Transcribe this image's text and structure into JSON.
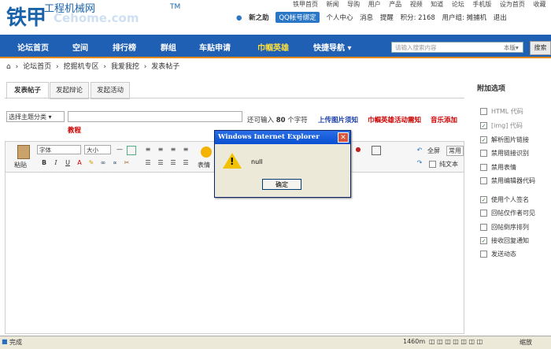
{
  "logo": {
    "brand": "铁甲",
    "subtitle": "工程机械网",
    "trademark": "TM",
    "watermark": "Cehome.com"
  },
  "toplinks": [
    "铁甲首页",
    "新闻",
    "导购",
    "用户",
    "产品",
    "视频",
    "知道",
    "论坛",
    "手机版",
    "设为首页",
    "收藏"
  ],
  "userbar": {
    "username": "新之助",
    "qq_bind": "QQ帐号绑定",
    "links": [
      "个人中心",
      "消息",
      "提醒"
    ],
    "points": "积分: 2168",
    "group": "用户组: 摊捕机",
    "logout": "退出"
  },
  "nav": {
    "items": [
      "论坛首页",
      "空间",
      "排行榜",
      "群组",
      "车贴申请",
      "巾帼英雄",
      "快捷导航 ▾"
    ],
    "highlight_color": "#ffdf3a"
  },
  "search": {
    "placeholder": "请输入搜索内容",
    "scope": "本版▾",
    "button": "搜索"
  },
  "breadcrumb": [
    "论坛首页",
    "挖掘机专区",
    "我爱我挖",
    "发表帖子"
  ],
  "tabs": [
    "发表帖子",
    "发起辩论",
    "发起活动"
  ],
  "subject_row": {
    "category": "选择主题分类 ▾",
    "hint_prefix": "还可输入",
    "hint_count": "80",
    "hint_suffix": "个字符",
    "upload_notice": "上传图片须知",
    "activity_notice": "巾帼英雄活动需知",
    "music_tutorial_1": "音乐添加",
    "music_tutorial_2": "教程"
  },
  "editor": {
    "paste": "粘贴",
    "font": "字体",
    "size": "大小",
    "emoticon": "表情",
    "fullscreen": "全屏",
    "common": "常用",
    "plaintext": "纯文本"
  },
  "sidebar": {
    "title": "附加选项",
    "options": [
      {
        "label": "HTML 代码",
        "checked": false,
        "dim": true
      },
      {
        "label": "[img] 代码",
        "checked": true,
        "dim": true
      },
      {
        "label": "解析图片链接",
        "checked": true,
        "dim": false
      },
      {
        "label": "禁用链接识别",
        "checked": false,
        "dim": false
      },
      {
        "label": "禁用表情",
        "checked": false,
        "dim": false
      },
      {
        "label": "禁用编辑器代码",
        "checked": false,
        "dim": false
      },
      {
        "label": "使用个人签名",
        "checked": true,
        "dim": false
      },
      {
        "label": "回帖仅作者可见",
        "checked": false,
        "dim": false
      },
      {
        "label": "回帖倒序排列",
        "checked": false,
        "dim": false
      },
      {
        "label": "接收回复通知",
        "checked": true,
        "dim": false
      },
      {
        "label": "发送动态",
        "checked": false,
        "dim": false
      }
    ]
  },
  "dialog": {
    "title": "Windows Internet Explorer",
    "message": "null",
    "ok": "确定"
  },
  "statusbar": {
    "status": "完成",
    "zone": "1460m",
    "zoom": "缩放"
  }
}
